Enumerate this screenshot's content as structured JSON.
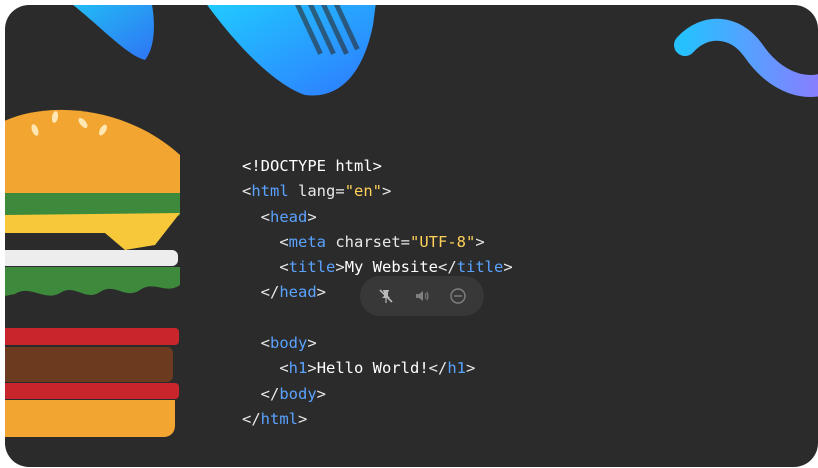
{
  "code": {
    "lines": [
      [
        {
          "t": "<!DOCTYPE html>",
          "c": "txt"
        }
      ],
      [
        {
          "t": "<",
          "c": "punct"
        },
        {
          "t": "html",
          "c": "tag"
        },
        {
          "t": " lang",
          "c": "attr"
        },
        {
          "t": "=",
          "c": "punct"
        },
        {
          "t": "\"en\"",
          "c": "str"
        },
        {
          "t": ">",
          "c": "punct"
        }
      ],
      [
        {
          "t": "  <",
          "c": "punct"
        },
        {
          "t": "head",
          "c": "tag"
        },
        {
          "t": ">",
          "c": "punct"
        }
      ],
      [
        {
          "t": "    <",
          "c": "punct"
        },
        {
          "t": "meta",
          "c": "tag"
        },
        {
          "t": " charset",
          "c": "attr"
        },
        {
          "t": "=",
          "c": "punct"
        },
        {
          "t": "\"UTF-8\"",
          "c": "str"
        },
        {
          "t": ">",
          "c": "punct"
        }
      ],
      [
        {
          "t": "    <",
          "c": "punct"
        },
        {
          "t": "title",
          "c": "tag"
        },
        {
          "t": ">",
          "c": "punct"
        },
        {
          "t": "My Website",
          "c": "txt"
        },
        {
          "t": "</",
          "c": "punct"
        },
        {
          "t": "title",
          "c": "tag"
        },
        {
          "t": ">",
          "c": "punct"
        }
      ],
      [
        {
          "t": "  </",
          "c": "punct"
        },
        {
          "t": "head",
          "c": "tag"
        },
        {
          "t": ">",
          "c": "punct"
        }
      ],
      [
        {
          "t": "",
          "c": "txt"
        }
      ],
      [
        {
          "t": "  <",
          "c": "punct"
        },
        {
          "t": "body",
          "c": "tag"
        },
        {
          "t": ">",
          "c": "punct"
        }
      ],
      [
        {
          "t": "    <",
          "c": "punct"
        },
        {
          "t": "h1",
          "c": "tag"
        },
        {
          "t": ">",
          "c": "punct"
        },
        {
          "t": "Hello World!",
          "c": "txt"
        },
        {
          "t": "</",
          "c": "punct"
        },
        {
          "t": "h1",
          "c": "tag"
        },
        {
          "t": ">",
          "c": "punct"
        }
      ],
      [
        {
          "t": "  </",
          "c": "punct"
        },
        {
          "t": "body",
          "c": "tag"
        },
        {
          "t": ">",
          "c": "punct"
        }
      ],
      [
        {
          "t": "</",
          "c": "punct"
        },
        {
          "t": "html",
          "c": "tag"
        },
        {
          "t": ">",
          "c": "punct"
        }
      ]
    ]
  },
  "controls": {
    "icons": [
      "pin-off-icon",
      "volume-icon",
      "minus-circle-icon"
    ]
  },
  "colors": {
    "background": "#2b2b2b",
    "tag": "#5aa2ff",
    "string": "#ffd15a",
    "text": "#e8e8e8",
    "accent_gradient_start": "#27c0ff",
    "accent_gradient_end": "#8a7dff"
  }
}
